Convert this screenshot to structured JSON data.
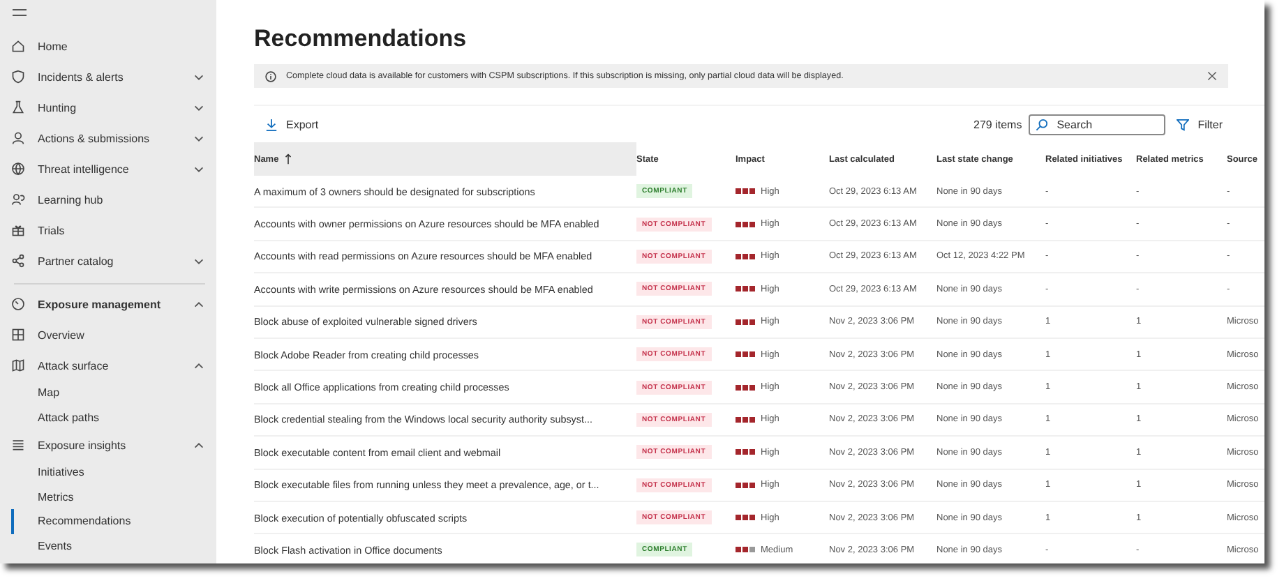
{
  "sidebar": {
    "items": [
      {
        "label": "Home",
        "selected": false
      },
      {
        "label": "Incidents & alerts",
        "selected": false,
        "expanded": false
      },
      {
        "label": "Hunting",
        "selected": false,
        "expanded": false
      },
      {
        "label": "Actions & submissions",
        "selected": false,
        "expanded": false
      },
      {
        "label": "Threat intelligence",
        "selected": false,
        "expanded": false
      },
      {
        "label": "Learning hub",
        "selected": false
      },
      {
        "label": "Trials",
        "selected": false
      },
      {
        "label": "Partner catalog",
        "selected": false,
        "expanded": false
      }
    ],
    "section": {
      "label": "Exposure management",
      "expanded": true,
      "children": [
        {
          "label": "Overview",
          "selected": false
        },
        {
          "label": "Attack surface",
          "selected": false,
          "expanded": true,
          "children": [
            {
              "label": "Map",
              "selected": false
            },
            {
              "label": "Attack paths",
              "selected": false
            }
          ]
        },
        {
          "label": "Exposure insights",
          "selected": false,
          "expanded": true,
          "children": [
            {
              "label": "Initiatives",
              "selected": false
            },
            {
              "label": "Metrics",
              "selected": false
            },
            {
              "label": "Recommendations",
              "selected": true
            },
            {
              "label": "Events",
              "selected": false
            }
          ]
        }
      ]
    }
  },
  "page": {
    "title": "Recommendations",
    "banner": "Complete cloud data is available for customers with CSPM subscriptions. If this subscription is missing, only partial cloud data will be displayed.",
    "toolbar": {
      "export": "Export",
      "count": "279 items",
      "search": {
        "placeholder": "Search"
      },
      "filter": "Filter"
    },
    "table": {
      "columns": [
        "Name",
        "State",
        "Impact",
        "Last calculated",
        "Last state change",
        "Related initiatives",
        "Related metrics",
        "Source"
      ],
      "rows": [
        {
          "name": "A maximum of 3 owners should be designated for subscriptions",
          "state": {
            "kind": "compliant",
            "label": "COMPLIANT"
          },
          "impact": {
            "stars": 3,
            "label": "High"
          },
          "last_calculated": "Oct 29, 2023 6:13 AM",
          "last_state_change": "None in 90 days",
          "related_initiatives": "-",
          "related_metrics": "-",
          "source": "-"
        },
        {
          "name": "Accounts with owner permissions on Azure resources should be MFA enabled",
          "state": {
            "kind": "not_compliant",
            "label": "NOT COMPLIANT"
          },
          "impact": {
            "stars": 3,
            "label": "High"
          },
          "last_calculated": "Oct 29, 2023 6:13 AM",
          "last_state_change": "None in 90 days",
          "related_initiatives": "-",
          "related_metrics": "-",
          "source": "-"
        },
        {
          "name": "Accounts with read permissions on Azure resources should be MFA enabled",
          "state": {
            "kind": "not_compliant",
            "label": "NOT COMPLIANT"
          },
          "impact": {
            "stars": 3,
            "label": "High"
          },
          "last_calculated": "Oct 29, 2023 6:13 AM",
          "last_state_change": "Oct 12, 2023 4:22 PM",
          "related_initiatives": "-",
          "related_metrics": "-",
          "source": "-"
        },
        {
          "name": "Accounts with write permissions on Azure resources should be MFA enabled",
          "state": {
            "kind": "not_compliant",
            "label": "NOT COMPLIANT"
          },
          "impact": {
            "stars": 3,
            "label": "High"
          },
          "last_calculated": "Oct 29, 2023 6:13 AM",
          "last_state_change": "None in 90 days",
          "related_initiatives": "-",
          "related_metrics": "-",
          "source": "-"
        },
        {
          "name": "Block abuse of exploited vulnerable signed drivers",
          "state": {
            "kind": "not_compliant",
            "label": "NOT COMPLIANT"
          },
          "impact": {
            "stars": 3,
            "label": "High"
          },
          "last_calculated": "Nov 2, 2023 3:06 PM",
          "last_state_change": "None in 90 days",
          "related_initiatives": "1",
          "related_metrics": "1",
          "source": "Microso"
        },
        {
          "name": "Block Adobe Reader from creating child processes",
          "state": {
            "kind": "not_compliant",
            "label": "NOT COMPLIANT"
          },
          "impact": {
            "stars": 3,
            "label": "High"
          },
          "last_calculated": "Nov 2, 2023 3:06 PM",
          "last_state_change": "None in 90 days",
          "related_initiatives": "1",
          "related_metrics": "1",
          "source": "Microso"
        },
        {
          "name": "Block all Office applications from creating child processes",
          "state": {
            "kind": "not_compliant",
            "label": "NOT COMPLIANT"
          },
          "impact": {
            "stars": 3,
            "label": "High"
          },
          "last_calculated": "Nov 2, 2023 3:06 PM",
          "last_state_change": "None in 90 days",
          "related_initiatives": "1",
          "related_metrics": "1",
          "source": "Microso"
        },
        {
          "name": "Block credential stealing from the Windows local security authority subsyst...",
          "state": {
            "kind": "not_compliant",
            "label": "NOT COMPLIANT"
          },
          "impact": {
            "stars": 3,
            "label": "High"
          },
          "last_calculated": "Nov 2, 2023 3:06 PM",
          "last_state_change": "None in 90 days",
          "related_initiatives": "1",
          "related_metrics": "1",
          "source": "Microso"
        },
        {
          "name": "Block executable content from email client and webmail",
          "state": {
            "kind": "not_compliant",
            "label": "NOT COMPLIANT"
          },
          "impact": {
            "stars": 3,
            "label": "High"
          },
          "last_calculated": "Nov 2, 2023 3:06 PM",
          "last_state_change": "None in 90 days",
          "related_initiatives": "1",
          "related_metrics": "1",
          "source": "Microso"
        },
        {
          "name": "Block executable files from running unless they meet a prevalence, age, or t...",
          "state": {
            "kind": "not_compliant",
            "label": "NOT COMPLIANT"
          },
          "impact": {
            "stars": 3,
            "label": "High"
          },
          "last_calculated": "Nov 2, 2023 3:06 PM",
          "last_state_change": "None in 90 days",
          "related_initiatives": "1",
          "related_metrics": "1",
          "source": "Microso"
        },
        {
          "name": "Block execution of potentially obfuscated scripts",
          "state": {
            "kind": "not_compliant",
            "label": "NOT COMPLIANT"
          },
          "impact": {
            "stars": 3,
            "label": "High"
          },
          "last_calculated": "Nov 2, 2023 3:06 PM",
          "last_state_change": "None in 90 days",
          "related_initiatives": "1",
          "related_metrics": "1",
          "source": "Microso"
        },
        {
          "name": "Block Flash activation in Office documents",
          "state": {
            "kind": "compliant",
            "label": "COMPLIANT"
          },
          "impact": {
            "stars": 2,
            "label": "Medium"
          },
          "last_calculated": "Nov 2, 2023 3:06 PM",
          "last_state_change": "None in 90 days",
          "related_initiatives": "-",
          "related_metrics": "-",
          "source": "Microso"
        }
      ]
    }
  }
}
